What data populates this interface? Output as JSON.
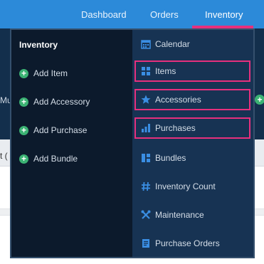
{
  "topnav": {
    "items": [
      "Dashboard",
      "Orders",
      "Inventory"
    ],
    "active": "Inventory"
  },
  "background": {
    "partial_text_left": "Mul",
    "partial_text_paren": "t ("
  },
  "dropdown": {
    "heading": "Inventory",
    "left_items": [
      "Add Item",
      "Add Accessory",
      "Add Purchase",
      "Add Bundle"
    ],
    "right_items": [
      {
        "label": "Calendar",
        "icon": "calendar-icon"
      },
      {
        "label": "Items",
        "icon": "grid-icon"
      },
      {
        "label": "Accessories",
        "icon": "star-icon"
      },
      {
        "label": "Purchases",
        "icon": "bar-chart-icon"
      },
      {
        "label": "Bundles",
        "icon": "bundle-icon"
      },
      {
        "label": "Inventory Count",
        "icon": "hash-icon"
      },
      {
        "label": "Maintenance",
        "icon": "tools-icon"
      },
      {
        "label": "Purchase Orders",
        "icon": "document-icon"
      }
    ],
    "highlighted": [
      "Items",
      "Accessories",
      "Purchases"
    ]
  },
  "colors": {
    "nav_bg": "#2c8ad9",
    "accent_pink": "#e6307d",
    "dropdown_left_bg": "#0c1a2c",
    "dropdown_right_bg": "#173353",
    "plus_green": "#3bb273",
    "icon_blue": "#3a8ee3"
  }
}
